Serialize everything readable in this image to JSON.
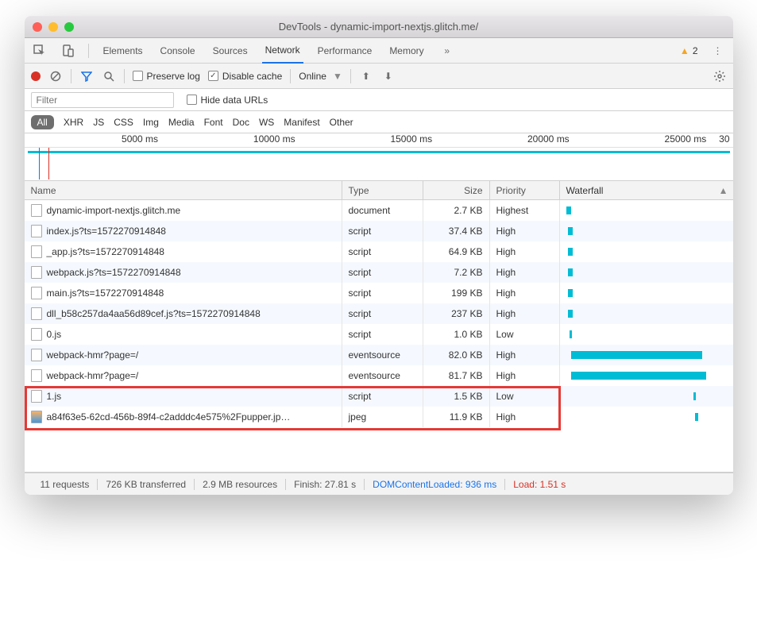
{
  "title": "DevTools - dynamic-import-nextjs.glitch.me/",
  "tabs": [
    "Elements",
    "Console",
    "Sources",
    "Network",
    "Performance",
    "Memory"
  ],
  "activeTab": 3,
  "warnCount": "2",
  "toolbar": {
    "preserve": "Preserve log",
    "disable": "Disable cache",
    "throttle": "Online"
  },
  "filter": {
    "placeholder": "Filter",
    "hide": "Hide data URLs"
  },
  "types": [
    "All",
    "XHR",
    "JS",
    "CSS",
    "Img",
    "Media",
    "Font",
    "Doc",
    "WS",
    "Manifest",
    "Other"
  ],
  "timelineTicks": [
    "5000 ms",
    "10000 ms",
    "15000 ms",
    "20000 ms",
    "25000 ms",
    "30"
  ],
  "headers": {
    "name": "Name",
    "type": "Type",
    "size": "Size",
    "priority": "Priority",
    "waterfall": "Waterfall"
  },
  "rows": [
    {
      "name": "dynamic-import-nextjs.glitch.me",
      "type": "document",
      "size": "2.7 KB",
      "priority": "Highest",
      "icon": "doc",
      "wf": {
        "l": 0,
        "w": 6
      }
    },
    {
      "name": "index.js?ts=1572270914848",
      "type": "script",
      "size": "37.4 KB",
      "priority": "High",
      "icon": "doc",
      "wf": {
        "l": 2,
        "w": 6
      }
    },
    {
      "name": "_app.js?ts=1572270914848",
      "type": "script",
      "size": "64.9 KB",
      "priority": "High",
      "icon": "doc",
      "wf": {
        "l": 2,
        "w": 6
      }
    },
    {
      "name": "webpack.js?ts=1572270914848",
      "type": "script",
      "size": "7.2 KB",
      "priority": "High",
      "icon": "doc",
      "wf": {
        "l": 2,
        "w": 6
      }
    },
    {
      "name": "main.js?ts=1572270914848",
      "type": "script",
      "size": "199 KB",
      "priority": "High",
      "icon": "doc",
      "wf": {
        "l": 2,
        "w": 6
      }
    },
    {
      "name": "dll_b58c257da4aa56d89cef.js?ts=1572270914848",
      "type": "script",
      "size": "237 KB",
      "priority": "High",
      "icon": "doc",
      "wf": {
        "l": 2,
        "w": 6
      }
    },
    {
      "name": "0.js",
      "type": "script",
      "size": "1.0 KB",
      "priority": "Low",
      "icon": "doc",
      "wf": {
        "l": 4,
        "w": 3
      }
    },
    {
      "name": "webpack-hmr?page=/",
      "type": "eventsource",
      "size": "82.0 KB",
      "priority": "High",
      "icon": "doc",
      "wf": {
        "l": 6,
        "w": 165
      }
    },
    {
      "name": "webpack-hmr?page=/",
      "type": "eventsource",
      "size": "81.7 KB",
      "priority": "High",
      "icon": "doc",
      "wf": {
        "l": 6,
        "w": 170
      }
    },
    {
      "name": "1.js",
      "type": "script",
      "size": "1.5 KB",
      "priority": "Low",
      "icon": "doc",
      "wf": {
        "l": 160,
        "w": 3
      }
    },
    {
      "name": "a84f63e5-62cd-456b-89f4-c2adddc4e575%2Fpupper.jp…",
      "type": "jpeg",
      "size": "11.9 KB",
      "priority": "High",
      "icon": "img",
      "wf": {
        "l": 162,
        "w": 4
      }
    }
  ],
  "status": {
    "requests": "11 requests",
    "transferred": "726 KB transferred",
    "resources": "2.9 MB resources",
    "finish": "Finish: 27.81 s",
    "dcl": "DOMContentLoaded: 936 ms",
    "load": "Load: 1.51 s"
  }
}
